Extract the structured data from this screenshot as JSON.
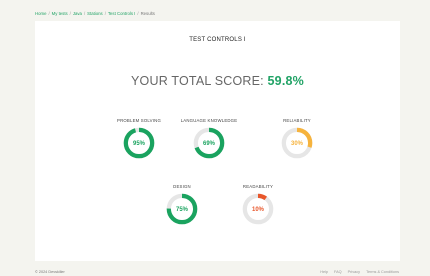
{
  "breadcrumb": {
    "items": [
      "Home",
      "My tests",
      "Java",
      "Stations",
      "Test Controls I",
      "Results"
    ]
  },
  "card": {
    "title": "TEST CONTROLS I",
    "score_prefix": "YOUR TOTAL SCORE: ",
    "score_value": "59.8%"
  },
  "metrics": [
    {
      "label": "PROBLEM SOLVING",
      "percent_text": "95%",
      "value": 0.95,
      "color": "#1aa35f",
      "text_color": "#1aa35f"
    },
    {
      "label": "LANGUAGE KNOWLEDGE",
      "percent_text": "69%",
      "value": 0.69,
      "color": "#1aa35f",
      "text_color": "#1aa35f"
    },
    {
      "label": "RELIABILITY",
      "percent_text": "30%",
      "value": 0.3,
      "color": "#f6b33d",
      "text_color": "#f6b33d"
    },
    {
      "label": "DESIGN",
      "percent_text": "75%",
      "value": 0.75,
      "color": "#1aa35f",
      "text_color": "#1aa35f"
    },
    {
      "label": "READABILITY",
      "percent_text": "10%",
      "value": 0.1,
      "color": "#e8562a",
      "text_color": "#e8562a"
    }
  ],
  "ring_track_color": "#e6e6e6",
  "footer": {
    "copyright": "© 2024 Devskiller",
    "links": [
      "Help",
      "FAQ",
      "Privacy",
      "Terms & Conditions"
    ]
  }
}
